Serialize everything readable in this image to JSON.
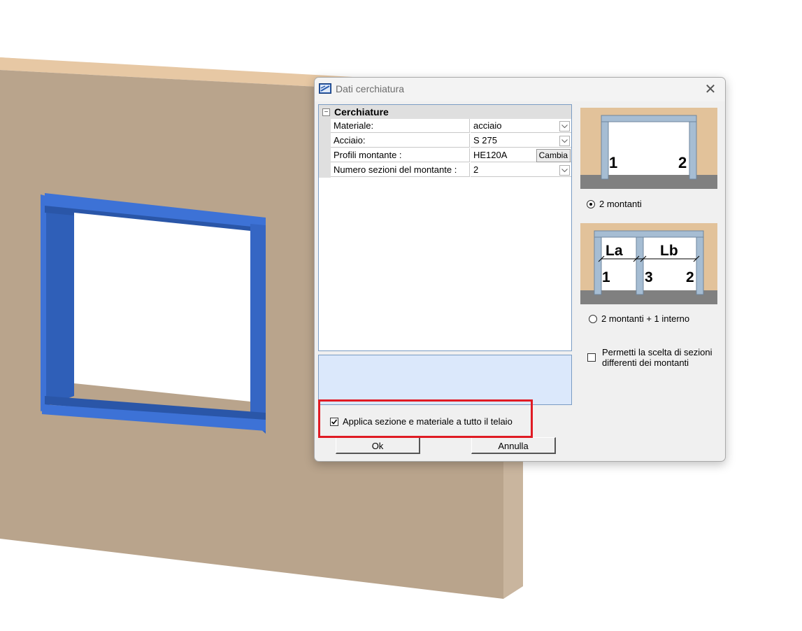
{
  "dialog": {
    "title": "Dati cerchiatura",
    "close_glyph": "✕",
    "grid": {
      "category": "Cerchiature",
      "collapse_glyph": "−",
      "rows": [
        {
          "label": "Materiale:",
          "value": "acciaio",
          "control": "dropdown"
        },
        {
          "label": "Acciaio:",
          "value": "S 275",
          "control": "dropdown"
        },
        {
          "label": "Profili montante :",
          "value": "HE120A",
          "control": "button",
          "button_label": "Cambia"
        },
        {
          "label": "Numero sezioni del montante :",
          "value": "2",
          "control": "dropdown"
        }
      ]
    },
    "options": {
      "two_posts": {
        "label": "2 montanti",
        "selected": true,
        "post_labels": [
          "1",
          "2"
        ]
      },
      "two_posts_plus_inner": {
        "label": "2 montanti + 1 interno",
        "selected": false,
        "post_labels": [
          "1",
          "3",
          "2"
        ],
        "span_labels": [
          "La",
          "Lb"
        ]
      },
      "different_sections": {
        "label_line1": "Permetti la scelta di sezioni",
        "label_line2": "differenti dei montanti",
        "checked": false
      }
    },
    "apply_all": {
      "label": "Applica sezione e materiale a tutto il telaio",
      "checked": true
    },
    "buttons": {
      "ok": "Ok",
      "cancel": "Annulla"
    }
  },
  "colors": {
    "wall": "#b9a48c",
    "wall_top": "#e7c8a4",
    "steel_frame": "#3d72d6",
    "highlight": "#e01b24",
    "diagram_wall": "#e2c29a",
    "diagram_ground": "#808080",
    "diagram_post": "#a6bdd3"
  }
}
